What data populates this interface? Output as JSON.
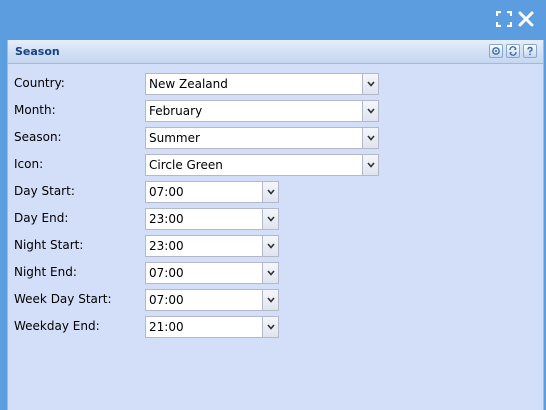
{
  "panel": {
    "title": "Season"
  },
  "fields": [
    {
      "label": "Country:",
      "value": "New Zealand"
    },
    {
      "label": "Month:",
      "value": "February"
    },
    {
      "label": "Season:",
      "value": "Summer"
    },
    {
      "label": "Icon:",
      "value": "Circle Green"
    },
    {
      "label": "Day Start:",
      "value": "07:00"
    },
    {
      "label": "Day End:",
      "value": "23:00"
    },
    {
      "label": "Night Start:",
      "value": "23:00"
    },
    {
      "label": "Night End:",
      "value": "07:00"
    },
    {
      "label": "Week Day Start:",
      "value": "07:00"
    },
    {
      "label": "Weekday End:",
      "value": "21:00"
    }
  ],
  "icons": {
    "maximize": "maximize-icon",
    "close": "close-icon",
    "gear": "gear-icon",
    "refresh": "refresh-icon",
    "help": "help-icon",
    "dropdown": "chevron-down-icon"
  },
  "colors": {
    "window_background": "#5b9ddf",
    "panel_background": "#d3def8",
    "panel_title": "#15428b"
  }
}
